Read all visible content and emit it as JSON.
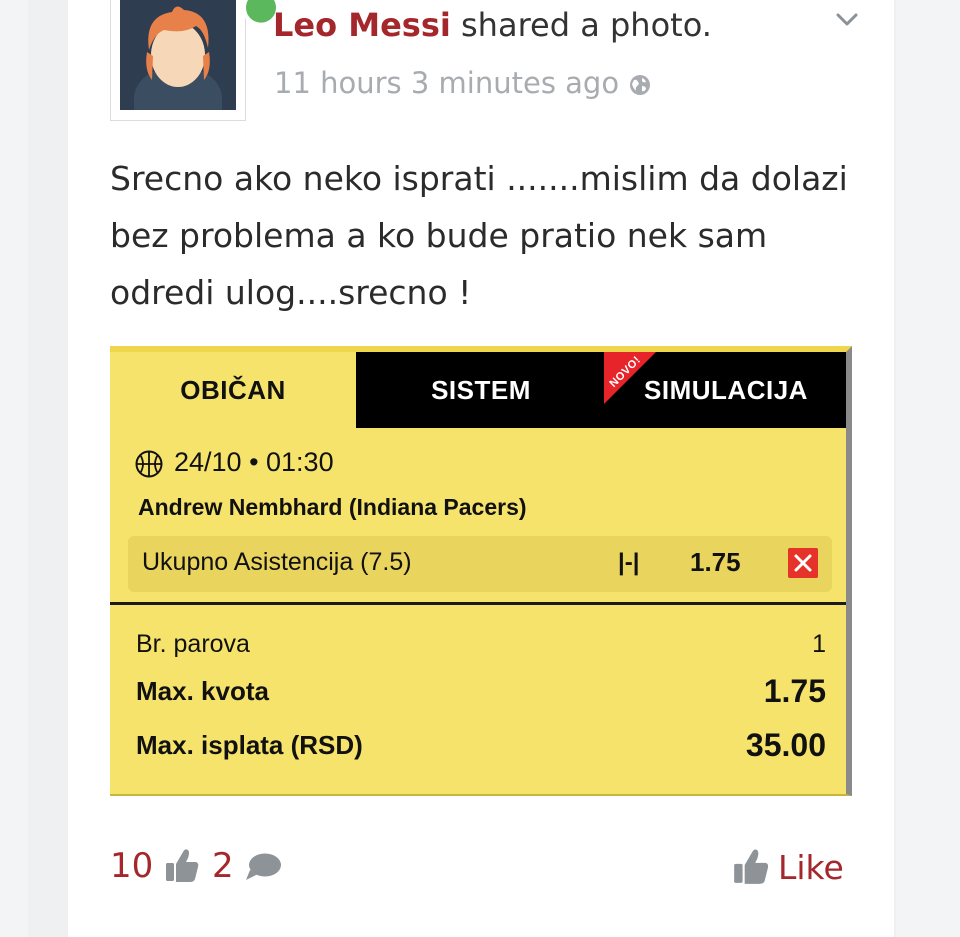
{
  "post": {
    "author_name": "Leo Messi",
    "action_text": " shared a photo.",
    "timestamp": "11 hours 3 minutes ago",
    "body_text": "Srecno ako neko isprati .......mislim da dolazi bez problema a ko bude pratio nek sam odredi ulog....srecno !"
  },
  "slip": {
    "tabs": [
      {
        "label": "OBIČAN",
        "active": true
      },
      {
        "label": "SISTEM",
        "active": false
      },
      {
        "label": "SIMULACIJA",
        "active": false
      }
    ],
    "new_badge": "NOVO!",
    "event_datetime": "24/10 • 01:30",
    "player": "Andrew Nembhard (Indiana Pacers)",
    "pick": {
      "market": "Ukupno Asistencija (7.5)",
      "type": "|-|",
      "odd": "1.75"
    },
    "summary": {
      "pairs_label": "Br. parova",
      "pairs_value": "1",
      "max_odd_label": "Max. kvota",
      "max_odd_value": "1.75",
      "max_payout_label": "Max. isplata (RSD)",
      "max_payout_value": "35.00"
    }
  },
  "footer": {
    "likes_count": "10",
    "comments_count": "2",
    "like_label": "Like"
  },
  "colors": {
    "brand": "#a4272c",
    "slip_yellow": "#f6e36b",
    "online": "#5cb85c",
    "remove": "#e5332a"
  },
  "icons": [
    "avatar",
    "online-status",
    "chevron-down-icon",
    "globe-icon",
    "basketball-icon",
    "close-icon",
    "thumbs-up-icon",
    "comment-icon"
  ]
}
